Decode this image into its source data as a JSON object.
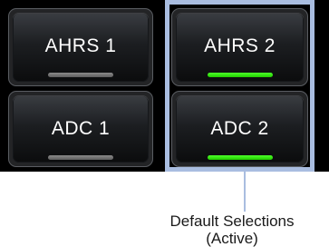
{
  "buttons": [
    {
      "label": "AHRS 1",
      "indicator": "inactive"
    },
    {
      "label": "AHRS 2",
      "indicator": "active"
    },
    {
      "label": "ADC 1",
      "indicator": "inactive"
    },
    {
      "label": "ADC 2",
      "indicator": "active"
    }
  ],
  "callout": {
    "line1": "Default Selections",
    "line2": "(Active)"
  },
  "colors": {
    "active_indicator": "#33ee11",
    "inactive_indicator": "#777777",
    "highlight_frame": "#a9bde0",
    "panel_background": "#000000"
  }
}
